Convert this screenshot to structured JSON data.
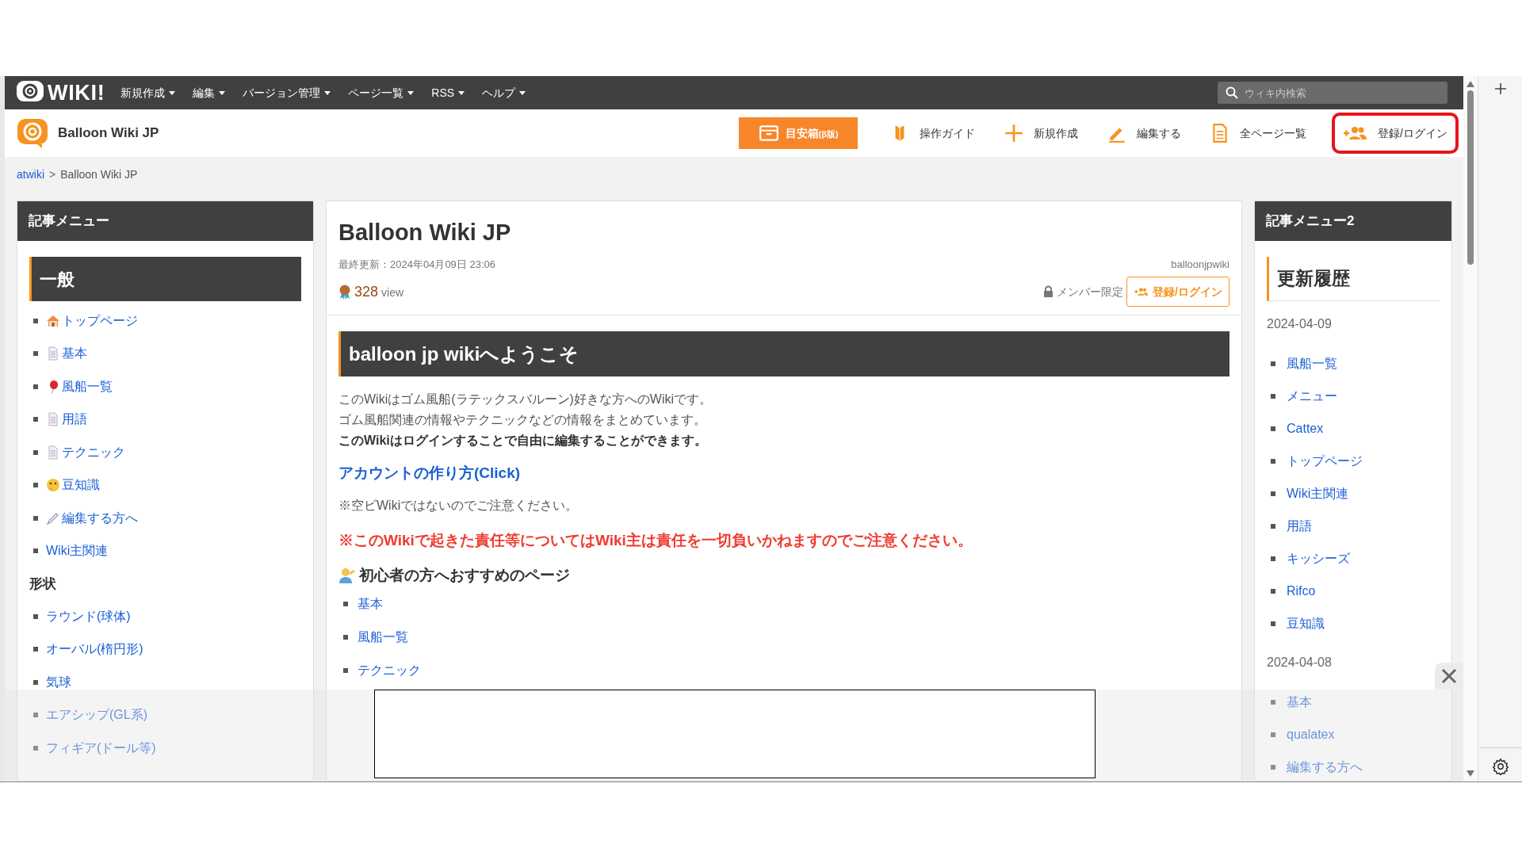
{
  "topbar": {
    "logo_text": "WIKI!",
    "menus": [
      {
        "label": "新規作成"
      },
      {
        "label": "編集"
      },
      {
        "label": "バージョン管理"
      },
      {
        "label": "ページ一覧"
      },
      {
        "label": "RSS"
      },
      {
        "label": "ヘルプ"
      }
    ],
    "search": {
      "placeholder": "ウィキ内検索"
    }
  },
  "header": {
    "site_name": "Balloon Wiki JP",
    "actions": [
      {
        "kind": "box",
        "label": "目安箱",
        "suffix": "(β版)",
        "highlighted": false
      },
      {
        "kind": "guide",
        "label": "操作ガイド",
        "highlighted": false
      },
      {
        "kind": "plus",
        "label": "新規作成",
        "highlighted": false
      },
      {
        "kind": "pencil",
        "label": "編集する",
        "highlighted": false
      },
      {
        "kind": "pages",
        "label": "全ページ一覧",
        "highlighted": false
      },
      {
        "kind": "users",
        "label": "登録/ログイン",
        "highlighted": true
      }
    ]
  },
  "breadcrumb": {
    "separator": ">",
    "items": [
      {
        "label": "atwiki",
        "link": true
      },
      {
        "label": "Balloon Wiki JP",
        "link": false
      }
    ]
  },
  "left_menu": {
    "title": "記事メニュー",
    "sections": [
      {
        "heading": "一般",
        "kind": "banner",
        "items": [
          "トップページ",
          "基本",
          "風船一覧",
          "用語",
          "テクニック",
          "豆知識",
          "編集する方へ",
          "Wiki主関連"
        ]
      },
      {
        "heading": "形状",
        "kind": "plain",
        "items": [
          "ラウンド(球体)",
          "オーバル(楕円形)",
          "気球",
          "エアシップ(GL系)",
          "フィギア(ドール等)"
        ]
      }
    ]
  },
  "article": {
    "title": "Balloon Wiki JP",
    "updated": "最終更新：2024年04月09日 23:06",
    "author": "balloonjpwiki",
    "views": "328",
    "views_unit": "view",
    "member_only": "メンバー限定",
    "login_button": "登録/ログイン",
    "heading": "balloon jp wikiへようこそ",
    "intro": [
      {
        "text": "このWikiはゴム風船(ラテックスバルーン)好きな方へのWikiです。",
        "bold": false
      },
      {
        "text": "ゴム風船関連の情報やテクニックなどの情報をまとめています。",
        "bold": false
      },
      {
        "text": "このWikiはログインすることで自由に編集することができます。",
        "bold": true
      }
    ],
    "link": "アカウントの作り方(Click)",
    "note": "※空ビWikiではないのでご注意ください。",
    "warning": "※このWikiで起きた責任等についてはWiki主は責任を一切負いかねますのでご注意ください。",
    "subheading": "初心者の方へおすすめのページ",
    "recommended": [
      "基本",
      "風船一覧",
      "テクニック"
    ]
  },
  "right_menu": {
    "title": "記事メニュー2",
    "heading": "更新履歴",
    "groups": [
      {
        "date": "2024-04-09",
        "items": [
          "風船一覧",
          "メニュー",
          "Cattex",
          "トップページ",
          "Wiki主関連",
          "用語",
          "キッシーズ",
          "Rifco",
          "豆知識"
        ]
      },
      {
        "date": "2024-04-08",
        "items": [
          "基本",
          "qualatex",
          "編集する方へ"
        ]
      }
    ]
  }
}
